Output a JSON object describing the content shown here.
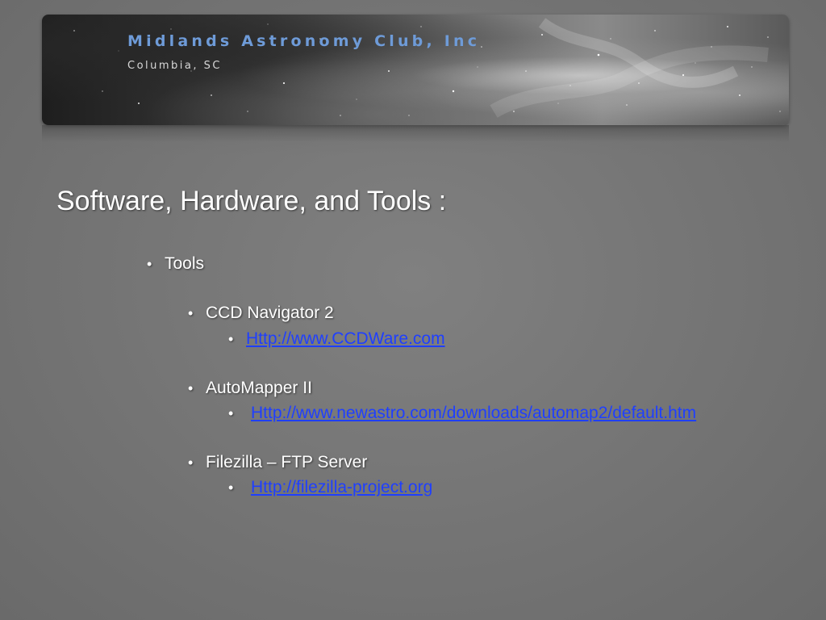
{
  "banner": {
    "title": "Midlands Astronomy Club, Inc",
    "subtitle": "Columbia, SC"
  },
  "slide": {
    "title": "Software, Hardware, and Tools :",
    "section": "Tools",
    "tools": [
      {
        "name": "CCD Navigator 2",
        "link": "Http://www.CCDWare.com"
      },
      {
        "name": "AutoMapper II",
        "link": "Http://www.newastro.com/downloads/automap2/default.htm"
      },
      {
        "name": "Filezilla – FTP Server",
        "link": "Http://filezilla-project.org"
      }
    ],
    "bullet": "•"
  },
  "colors": {
    "link": "#1f3fff",
    "banner_title": "#6e9bd8"
  }
}
